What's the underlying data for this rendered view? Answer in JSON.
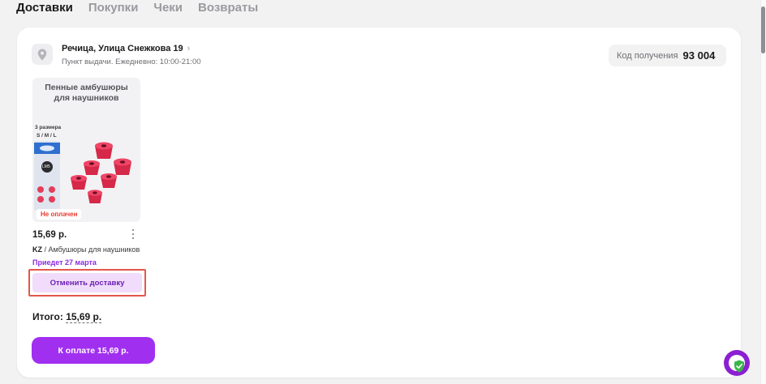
{
  "tabs": [
    {
      "label": "Доставки",
      "active": true
    },
    {
      "label": "Покупки",
      "active": false
    },
    {
      "label": "Чеки",
      "active": false
    },
    {
      "label": "Возвраты",
      "active": false
    }
  ],
  "delivery": {
    "address": "Речица, Улица Снежкова 19",
    "pickup_info": "Пункт выдачи. Ежедневно: 10:00-21:00",
    "code_label": "Код получения",
    "code_value": "93 004"
  },
  "product": {
    "image_title": "Пенные амбушюры для наушников",
    "image_sizes_caption": "3 размера",
    "image_sizes": "S / M / L",
    "image_pack_label": "LM5",
    "status_badge": "Не оплачен",
    "price": "15,69 р.",
    "seller": "KZ",
    "separator": " / ",
    "name": "Амбушюры для наушников",
    "arrival": "Приедет 27 марта",
    "cancel_label": "Отменить доставку"
  },
  "summary": {
    "total_label": "Итого:",
    "total_value": "15,69 р.",
    "pay_button": "К оплате 15,69 р."
  },
  "icons": {
    "location": "map-pin-icon",
    "chevron": "chevron-right-icon",
    "menu": "kebab-menu-icon",
    "widget": "shield-check-icon"
  },
  "colors": {
    "accent": "#a12ff0",
    "accent_light": "#f1dcfb",
    "accent_text": "#6c1fb3",
    "arrival_text": "#8a2be2",
    "unpaid_text": "#e8392d",
    "highlight_border": "#e4574b",
    "shield_green": "#3bb54a"
  }
}
